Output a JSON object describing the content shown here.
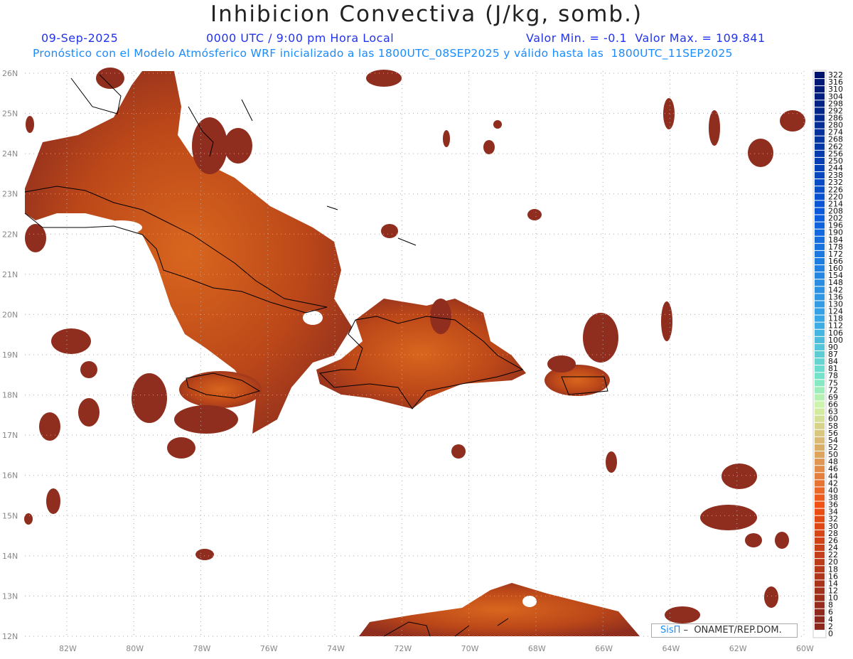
{
  "header": {
    "title": "Inhibicion Convectiva (J/kg, somb.)",
    "date": "09-Sep-2025",
    "time": "0000 UTC / 9:00 pm Hora Local",
    "minmax": "Valor Min. = -0.1  Valor Max. = 109.841",
    "subtitle": "Pronóstico con el Modelo Atmósferico WRF inicializado a las 1800UTC_08SEP2025 y válido hasta las  1800UTC_11SEP2025"
  },
  "map": {
    "lat_labels": [
      "26N",
      "25N",
      "24N",
      "23N",
      "22N",
      "21N",
      "20N",
      "19N",
      "18N",
      "17N",
      "16N",
      "15N",
      "14N",
      "13N",
      "12N"
    ],
    "lon_labels": [
      "82W",
      "80W",
      "78W",
      "76W",
      "74W",
      "72W",
      "70W",
      "68W",
      "66W",
      "64W",
      "62W",
      "60W"
    ],
    "value_min": -0.1,
    "value_max": 109.841
  },
  "colorbar": {
    "labels": [
      "322",
      "316",
      "310",
      "304",
      "298",
      "292",
      "286",
      "280",
      "274",
      "268",
      "262",
      "256",
      "250",
      "244",
      "238",
      "232",
      "226",
      "220",
      "214",
      "208",
      "202",
      "196",
      "190",
      "184",
      "178",
      "172",
      "166",
      "160",
      "154",
      "148",
      "142",
      "136",
      "130",
      "124",
      "118",
      "112",
      "106",
      "100",
      "90",
      "87",
      "84",
      "81",
      "78",
      "75",
      "72",
      "69",
      "66",
      "63",
      "60",
      "58",
      "56",
      "54",
      "52",
      "50",
      "48",
      "46",
      "44",
      "42",
      "40",
      "38",
      "36",
      "34",
      "32",
      "30",
      "28",
      "26",
      "24",
      "22",
      "20",
      "18",
      "16",
      "14",
      "12",
      "10",
      "8",
      "6",
      "4",
      "2",
      "0"
    ]
  },
  "credit": {
    "logo": "SisΠ",
    "text": " –  ONAMET/REP.DOM."
  }
}
